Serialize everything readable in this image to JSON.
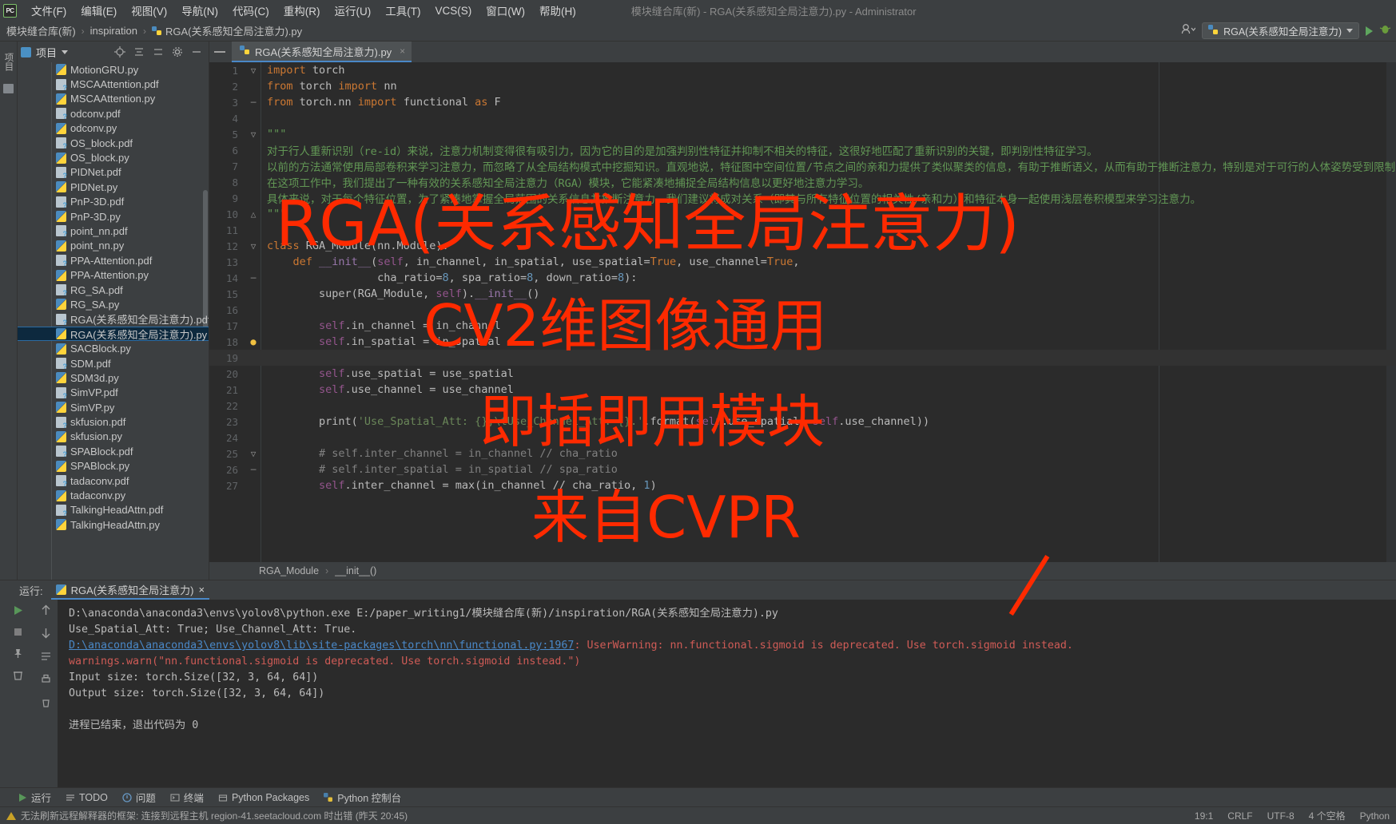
{
  "window": {
    "title": "模块缝合库(新) - RGA(关系感知全局注意力).py - Administrator",
    "logo_text": "PC"
  },
  "menubar": {
    "items": [
      {
        "label": "文件(F)"
      },
      {
        "label": "编辑(E)"
      },
      {
        "label": "视图(V)"
      },
      {
        "label": "导航(N)"
      },
      {
        "label": "代码(C)"
      },
      {
        "label": "重构(R)"
      },
      {
        "label": "运行(U)"
      },
      {
        "label": "工具(T)"
      },
      {
        "label": "VCS(S)"
      },
      {
        "label": "窗口(W)"
      },
      {
        "label": "帮助(H)"
      }
    ]
  },
  "breadcrumb": {
    "items": [
      "模块缝合库(新)",
      "inspiration",
      "RGA(关系感知全局注意力).py"
    ],
    "separator": "›"
  },
  "toolbar_right": {
    "run_config": "RGA(关系感知全局注意力)",
    "run_tooltip": "运行",
    "debug_tooltip": "调试"
  },
  "left_strip": {
    "tabs": [
      "项目"
    ]
  },
  "project_panel": {
    "title": "项目",
    "files": [
      {
        "name": "MotionGRU.py",
        "type": "py",
        "clipped": true
      },
      {
        "name": "MSCAAttention.pdf",
        "type": "pdf"
      },
      {
        "name": "MSCAAttention.py",
        "type": "py"
      },
      {
        "name": "odconv.pdf",
        "type": "pdf"
      },
      {
        "name": "odconv.py",
        "type": "py"
      },
      {
        "name": "OS_block.pdf",
        "type": "pdf"
      },
      {
        "name": "OS_block.py",
        "type": "py"
      },
      {
        "name": "PIDNet.pdf",
        "type": "pdf"
      },
      {
        "name": "PIDNet.py",
        "type": "py"
      },
      {
        "name": "PnP-3D.pdf",
        "type": "pdf"
      },
      {
        "name": "PnP-3D.py",
        "type": "py"
      },
      {
        "name": "point_nn.pdf",
        "type": "pdf"
      },
      {
        "name": "point_nn.py",
        "type": "py"
      },
      {
        "name": "PPA-Attention.pdf",
        "type": "pdf"
      },
      {
        "name": "PPA-Attention.py",
        "type": "py"
      },
      {
        "name": "RG_SA.pdf",
        "type": "pdf"
      },
      {
        "name": "RG_SA.py",
        "type": "py"
      },
      {
        "name": "RGA(关系感知全局注意力).pdf",
        "type": "pdf"
      },
      {
        "name": "RGA(关系感知全局注意力).py",
        "type": "py",
        "selected": true
      },
      {
        "name": "SACBlock.py",
        "type": "py"
      },
      {
        "name": "SDM.pdf",
        "type": "pdf"
      },
      {
        "name": "SDM3d.py",
        "type": "py"
      },
      {
        "name": "SimVP.pdf",
        "type": "pdf"
      },
      {
        "name": "SimVP.py",
        "type": "py"
      },
      {
        "name": "skfusion.pdf",
        "type": "pdf"
      },
      {
        "name": "skfusion.py",
        "type": "py"
      },
      {
        "name": "SPABlock.pdf",
        "type": "pdf"
      },
      {
        "name": "SPABlock.py",
        "type": "py"
      },
      {
        "name": "tadaconv.pdf",
        "type": "pdf"
      },
      {
        "name": "tadaconv.py",
        "type": "py"
      },
      {
        "name": "TalkingHeadAttn.pdf",
        "type": "pdf"
      },
      {
        "name": "TalkingHeadAttn.py",
        "type": "py",
        "clipped": true
      }
    ]
  },
  "editor": {
    "tab_label": "RGA(关系感知全局注意力).py",
    "tab_close": "×",
    "breadcrumb": [
      "RGA_Module",
      "__init__()"
    ],
    "breadcrumb_sep": "›",
    "lines": [
      {
        "n": 1,
        "text": "import torch",
        "fold": "▽"
      },
      {
        "n": 2,
        "text": "from torch import nn"
      },
      {
        "n": 3,
        "text": "from torch.nn import functional as F",
        "fold": "─"
      },
      {
        "n": 4,
        "text": ""
      },
      {
        "n": 5,
        "text": "\"\"\"",
        "fold": "▽"
      },
      {
        "n": 6,
        "text": "对于行人重新识别（re-id）来说，注意力机制变得很有吸引力，因为它的目的是加强判别性特征并抑制不相关的特征，这很好地匹配了重新识别的关键，即判别性特征学习。"
      },
      {
        "n": 7,
        "text": "以前的方法通常使用局部卷积来学习注意力，而忽略了从全局结构模式中挖掘知识。直观地说，特征图中空间位置/节点之间的亲和力提供了类似聚类的信息，有助于推断语义，从而有助于推断注意力，特别是对于可行的人体姿势受到限制的人"
      },
      {
        "n": 8,
        "text": "在这项工作中，我们提出了一种有效的关系感知全局注意力（RGA）模块，它能紧凑地捕捉全局结构信息以更好地注意力学习。"
      },
      {
        "n": 9,
        "text": "具体来说，对于每个特征位置，为了紧凑地掌握全局范围的关系信息并推断注意力，我们建议将成对关系（即其与所有特征位置的相关性/亲和力）和特征本身一起使用浅层卷积模型来学习注意力。"
      },
      {
        "n": 10,
        "text": "\"\"\"",
        "fold": "△"
      },
      {
        "n": 11,
        "text": ""
      },
      {
        "n": 12,
        "text": "class RGA_Module(nn.Module):",
        "fold": "▽"
      },
      {
        "n": 13,
        "text": "    def __init__(self, in_channel, in_spatial, use_spatial=True, use_channel=True,"
      },
      {
        "n": 14,
        "text": "                 cha_ratio=8, spa_ratio=8, down_ratio=8):",
        "fold": "─"
      },
      {
        "n": 15,
        "text": "        super(RGA_Module, self).__init__()"
      },
      {
        "n": 16,
        "text": ""
      },
      {
        "n": 17,
        "text": "        self.in_channel = in_channel"
      },
      {
        "n": 18,
        "text": "        self.in_spatial = in_spatial",
        "bulb": true
      },
      {
        "n": 19,
        "text": "",
        "current": true
      },
      {
        "n": 20,
        "text": "        self.use_spatial = use_spatial"
      },
      {
        "n": 21,
        "text": "        self.use_channel = use_channel"
      },
      {
        "n": 22,
        "text": ""
      },
      {
        "n": 23,
        "text": "        print('Use_Spatial_Att: {};\\tUse_Channel_Att: {}.'.format(self.use_spatial, self.use_channel))"
      },
      {
        "n": 24,
        "text": ""
      },
      {
        "n": 25,
        "text": "        # self.inter_channel = in_channel // cha_ratio",
        "fold": "▽"
      },
      {
        "n": 26,
        "text": "        # self.inter_spatial = in_spatial // spa_ratio",
        "fold": "─"
      },
      {
        "n": 27,
        "text": "        self.inter_channel = max(in_channel // cha_ratio, 1)"
      }
    ]
  },
  "run_panel": {
    "label": "运行:",
    "tab_name": "RGA(关系感知全局注意力)",
    "tab_close": "×",
    "console_lines": [
      {
        "text": "D:\\anaconda\\anaconda3\\envs\\yolov8\\python.exe E:/paper_writing1/模块缝合库(新)/inspiration/RGA(关系感知全局注意力).py",
        "style": "plain"
      },
      {
        "text": "Use_Spatial_Att: True;  Use_Channel_Att: True.",
        "style": "plain"
      },
      {
        "link": "D:\\anaconda\\anaconda3\\envs\\yolov8\\lib\\site-packages\\torch\\nn\\functional.py:1967",
        "text": ": UserWarning: nn.functional.sigmoid is deprecated. Use torch.sigmoid instead.",
        "style": "warn"
      },
      {
        "text": "  warnings.warn(\"nn.functional.sigmoid is deprecated. Use torch.sigmoid instead.\")",
        "style": "warn"
      },
      {
        "text": "Input size: torch.Size([32, 3, 64, 64])",
        "style": "plain"
      },
      {
        "text": "Output size: torch.Size([32, 3, 64, 64])",
        "style": "plain"
      },
      {
        "text": "",
        "style": "plain"
      },
      {
        "text": "进程已结束，退出代码为 0",
        "style": "plain"
      }
    ]
  },
  "bottom_tabs": {
    "items": [
      {
        "label": "运行",
        "icon": "play-icon"
      },
      {
        "label": "TODO",
        "icon": "list-icon"
      },
      {
        "label": "问题",
        "icon": "warning-icon"
      },
      {
        "label": "终端",
        "icon": "terminal-icon"
      },
      {
        "label": "Python Packages",
        "icon": "package-icon"
      },
      {
        "label": "Python 控制台",
        "icon": "console-icon"
      }
    ]
  },
  "statusbar": {
    "message": "无法刷新远程解释器的框架: 连接到远程主机 region-41.seetacloud.com 时出错 (昨天 20:45)",
    "caret": "19:1",
    "line_sep": "CRLF",
    "encoding": "UTF-8",
    "indent": "4 个空格",
    "interpreter": "Python"
  },
  "watermark": {
    "lines": [
      "RGA(关系感知全局注意力)",
      "CV2维图像通用",
      "即插即用模块",
      "来自CVPR"
    ],
    "color": "#ff2a00"
  }
}
